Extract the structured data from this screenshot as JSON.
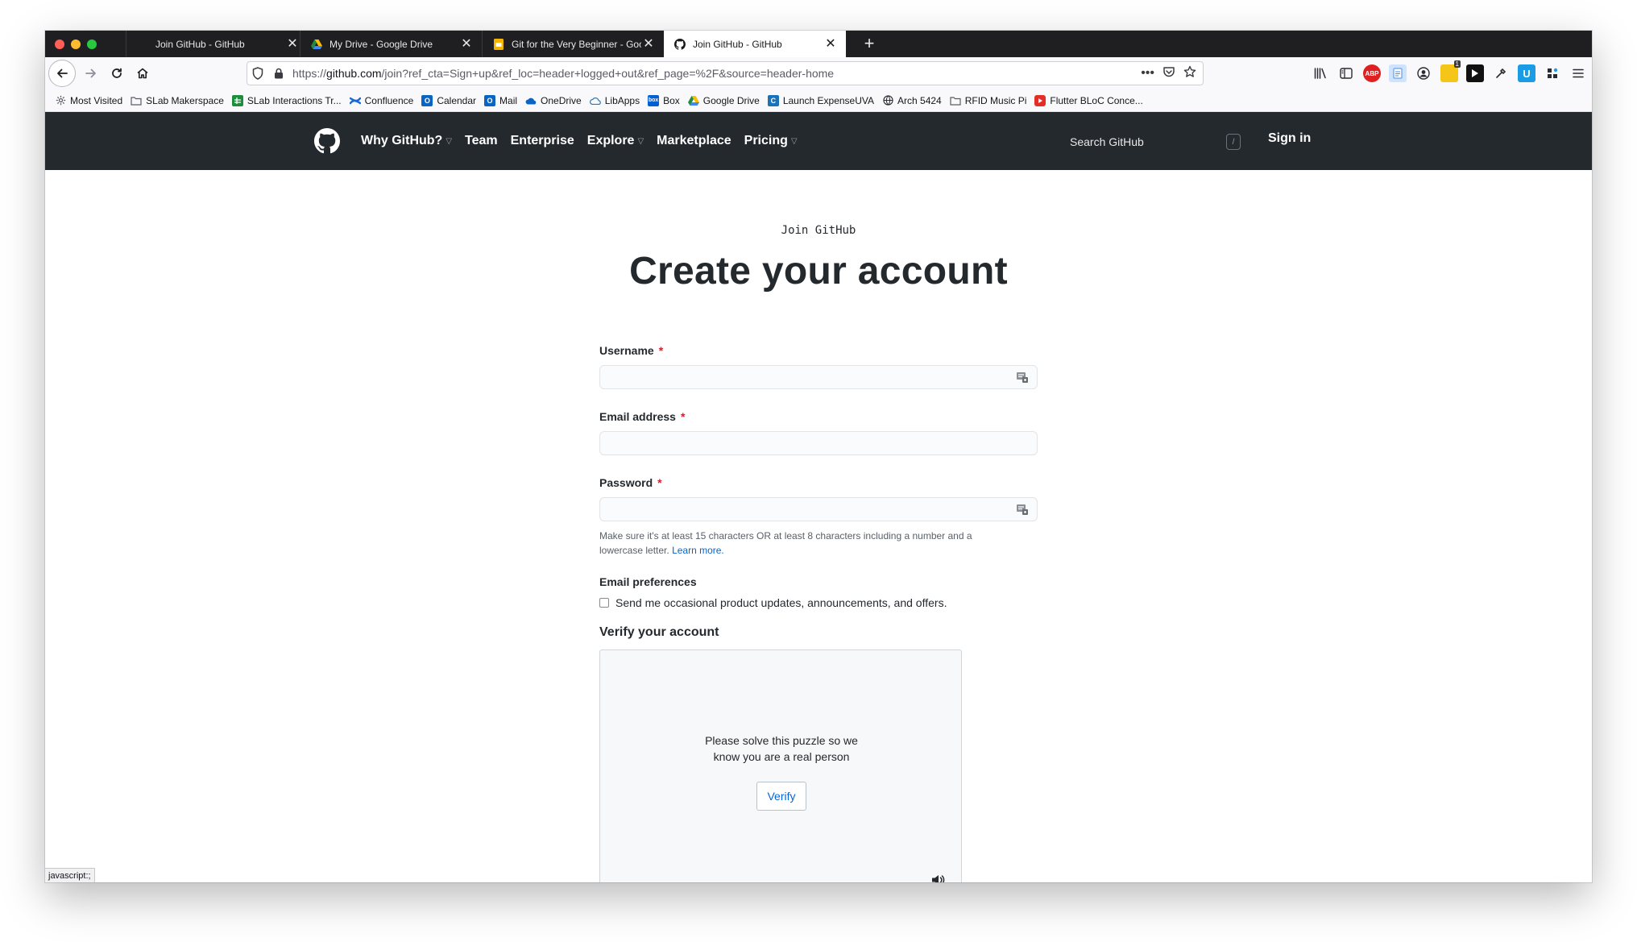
{
  "browser": {
    "tabs": [
      {
        "title": "Join GitHub - GitHub",
        "icon": "github-icon",
        "active": false
      },
      {
        "title": "My Drive - Google Drive",
        "icon": "google-drive-icon",
        "active": false
      },
      {
        "title": "Git for the Very Beginner - Goo",
        "icon": "google-slides-icon",
        "active": false
      },
      {
        "title": "Join GitHub - GitHub",
        "icon": "github-icon",
        "active": true
      }
    ],
    "new_tab_label": "+",
    "url_prefix": "https://",
    "url_domain": "github.com",
    "url_path": "/join?ref_cta=Sign+up&ref_loc=header+logged+out&ref_page=%2F&source=header-home",
    "url_more": "•••",
    "bookmarks": [
      {
        "label": "Most Visited",
        "icon": "gear-icon",
        "color": "#5b5b66"
      },
      {
        "label": "SLab Makerspace",
        "icon": "folder-icon",
        "color": "#5b5b66"
      },
      {
        "label": "SLab Interactions Tr...",
        "icon": "google-sheets-icon",
        "color": "#1e8e3e"
      },
      {
        "label": "Confluence",
        "icon": "confluence-icon",
        "color": "#1868db"
      },
      {
        "label": "Calendar",
        "icon": "outlook-calendar-icon",
        "color": "#0a64c4"
      },
      {
        "label": "Mail",
        "icon": "outlook-mail-icon",
        "color": "#0a64c4"
      },
      {
        "label": "OneDrive",
        "icon": "onedrive-icon",
        "color": "#0a64c4"
      },
      {
        "label": "LibApps",
        "icon": "libapps-icon",
        "color": "#2a7ab8"
      },
      {
        "label": "Box",
        "icon": "box-icon",
        "color": "#0061d5"
      },
      {
        "label": "Google Drive",
        "icon": "google-drive-icon",
        "color": "#1e8e3e"
      },
      {
        "label": "Launch ExpenseUVA",
        "icon": "expense-icon",
        "color": "#1a73b8"
      },
      {
        "label": "Arch 5424",
        "icon": "globe-icon",
        "color": "#2b2a33"
      },
      {
        "label": "RFID Music Pi",
        "icon": "folder-icon",
        "color": "#5b5b66"
      },
      {
        "label": "Flutter BLoC Conce...",
        "icon": "youtube-icon",
        "color": "#e52d27"
      }
    ],
    "status_text": "javascript:;"
  },
  "github": {
    "nav": [
      {
        "label": "Why GitHub?",
        "dropdown": true
      },
      {
        "label": "Team",
        "dropdown": false
      },
      {
        "label": "Enterprise",
        "dropdown": false
      },
      {
        "label": "Explore",
        "dropdown": true
      },
      {
        "label": "Marketplace",
        "dropdown": false
      },
      {
        "label": "Pricing",
        "dropdown": true
      }
    ],
    "search_placeholder": "Search GitHub",
    "search_shortcut": "/",
    "sign_in": "Sign in",
    "header_bg": "#24292e"
  },
  "form": {
    "eyebrow": "Join GitHub",
    "title": "Create your account",
    "required_marker": "*",
    "username_label": "Username",
    "username_value": "",
    "email_label": "Email address",
    "email_value": "",
    "password_label": "Password",
    "password_value": "",
    "password_hint": "Make sure it's at least 15 characters OR at least 8 characters including a number and a lowercase letter.",
    "learn_more": "Learn more.",
    "prefs_title": "Email preferences",
    "prefs_checkbox_label": "Send me occasional product updates, announcements, and offers.",
    "prefs_checked": false,
    "verify_title": "Verify your account",
    "puzzle_line1": "Please solve this puzzle so we",
    "puzzle_line2": "know you are a real person",
    "verify_button": "Verify"
  }
}
